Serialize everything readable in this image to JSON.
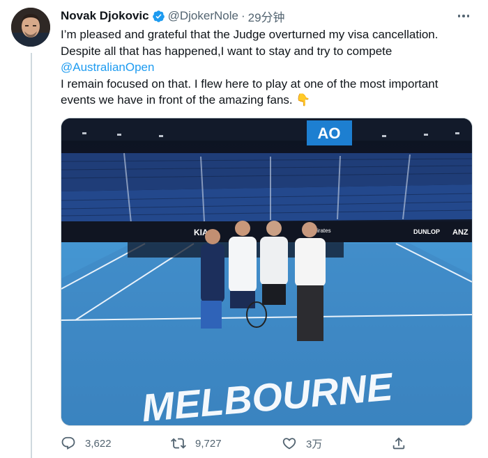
{
  "tweet": {
    "author_name": "Novak Djokovic",
    "handle": "@DjokerNole",
    "separator": "·",
    "time": "29分钟",
    "verified": true,
    "text": {
      "line1": "I’m pleased and grateful that the Judge overturned my visa cancellation.",
      "line2": "Despite all that has happened,I want to stay and try to compete",
      "mention": "@AustralianOpen",
      "line4": "I remain focused on that. I flew here to play at one of the most important",
      "line5": "events we have in front of the amazing fans.",
      "emoji": "👇"
    },
    "media": {
      "scoreboard_logo": "AO",
      "court_text": "MELBOURNE",
      "banner_texts": [
        "KIA",
        "Emirates",
        "DUNLOP",
        "ANZ"
      ]
    },
    "actions": {
      "replies": "3,622",
      "retweets": "9,727",
      "likes": "3万"
    }
  },
  "icons": {
    "verified": "verified-badge-icon",
    "more": "more-dots-icon",
    "reply": "reply-icon",
    "retweet": "retweet-icon",
    "like": "heart-icon",
    "share": "share-icon"
  },
  "colors": {
    "accent": "#1d9bf0",
    "secondary_text": "#536471",
    "court_blue": "#3a8fcf"
  }
}
